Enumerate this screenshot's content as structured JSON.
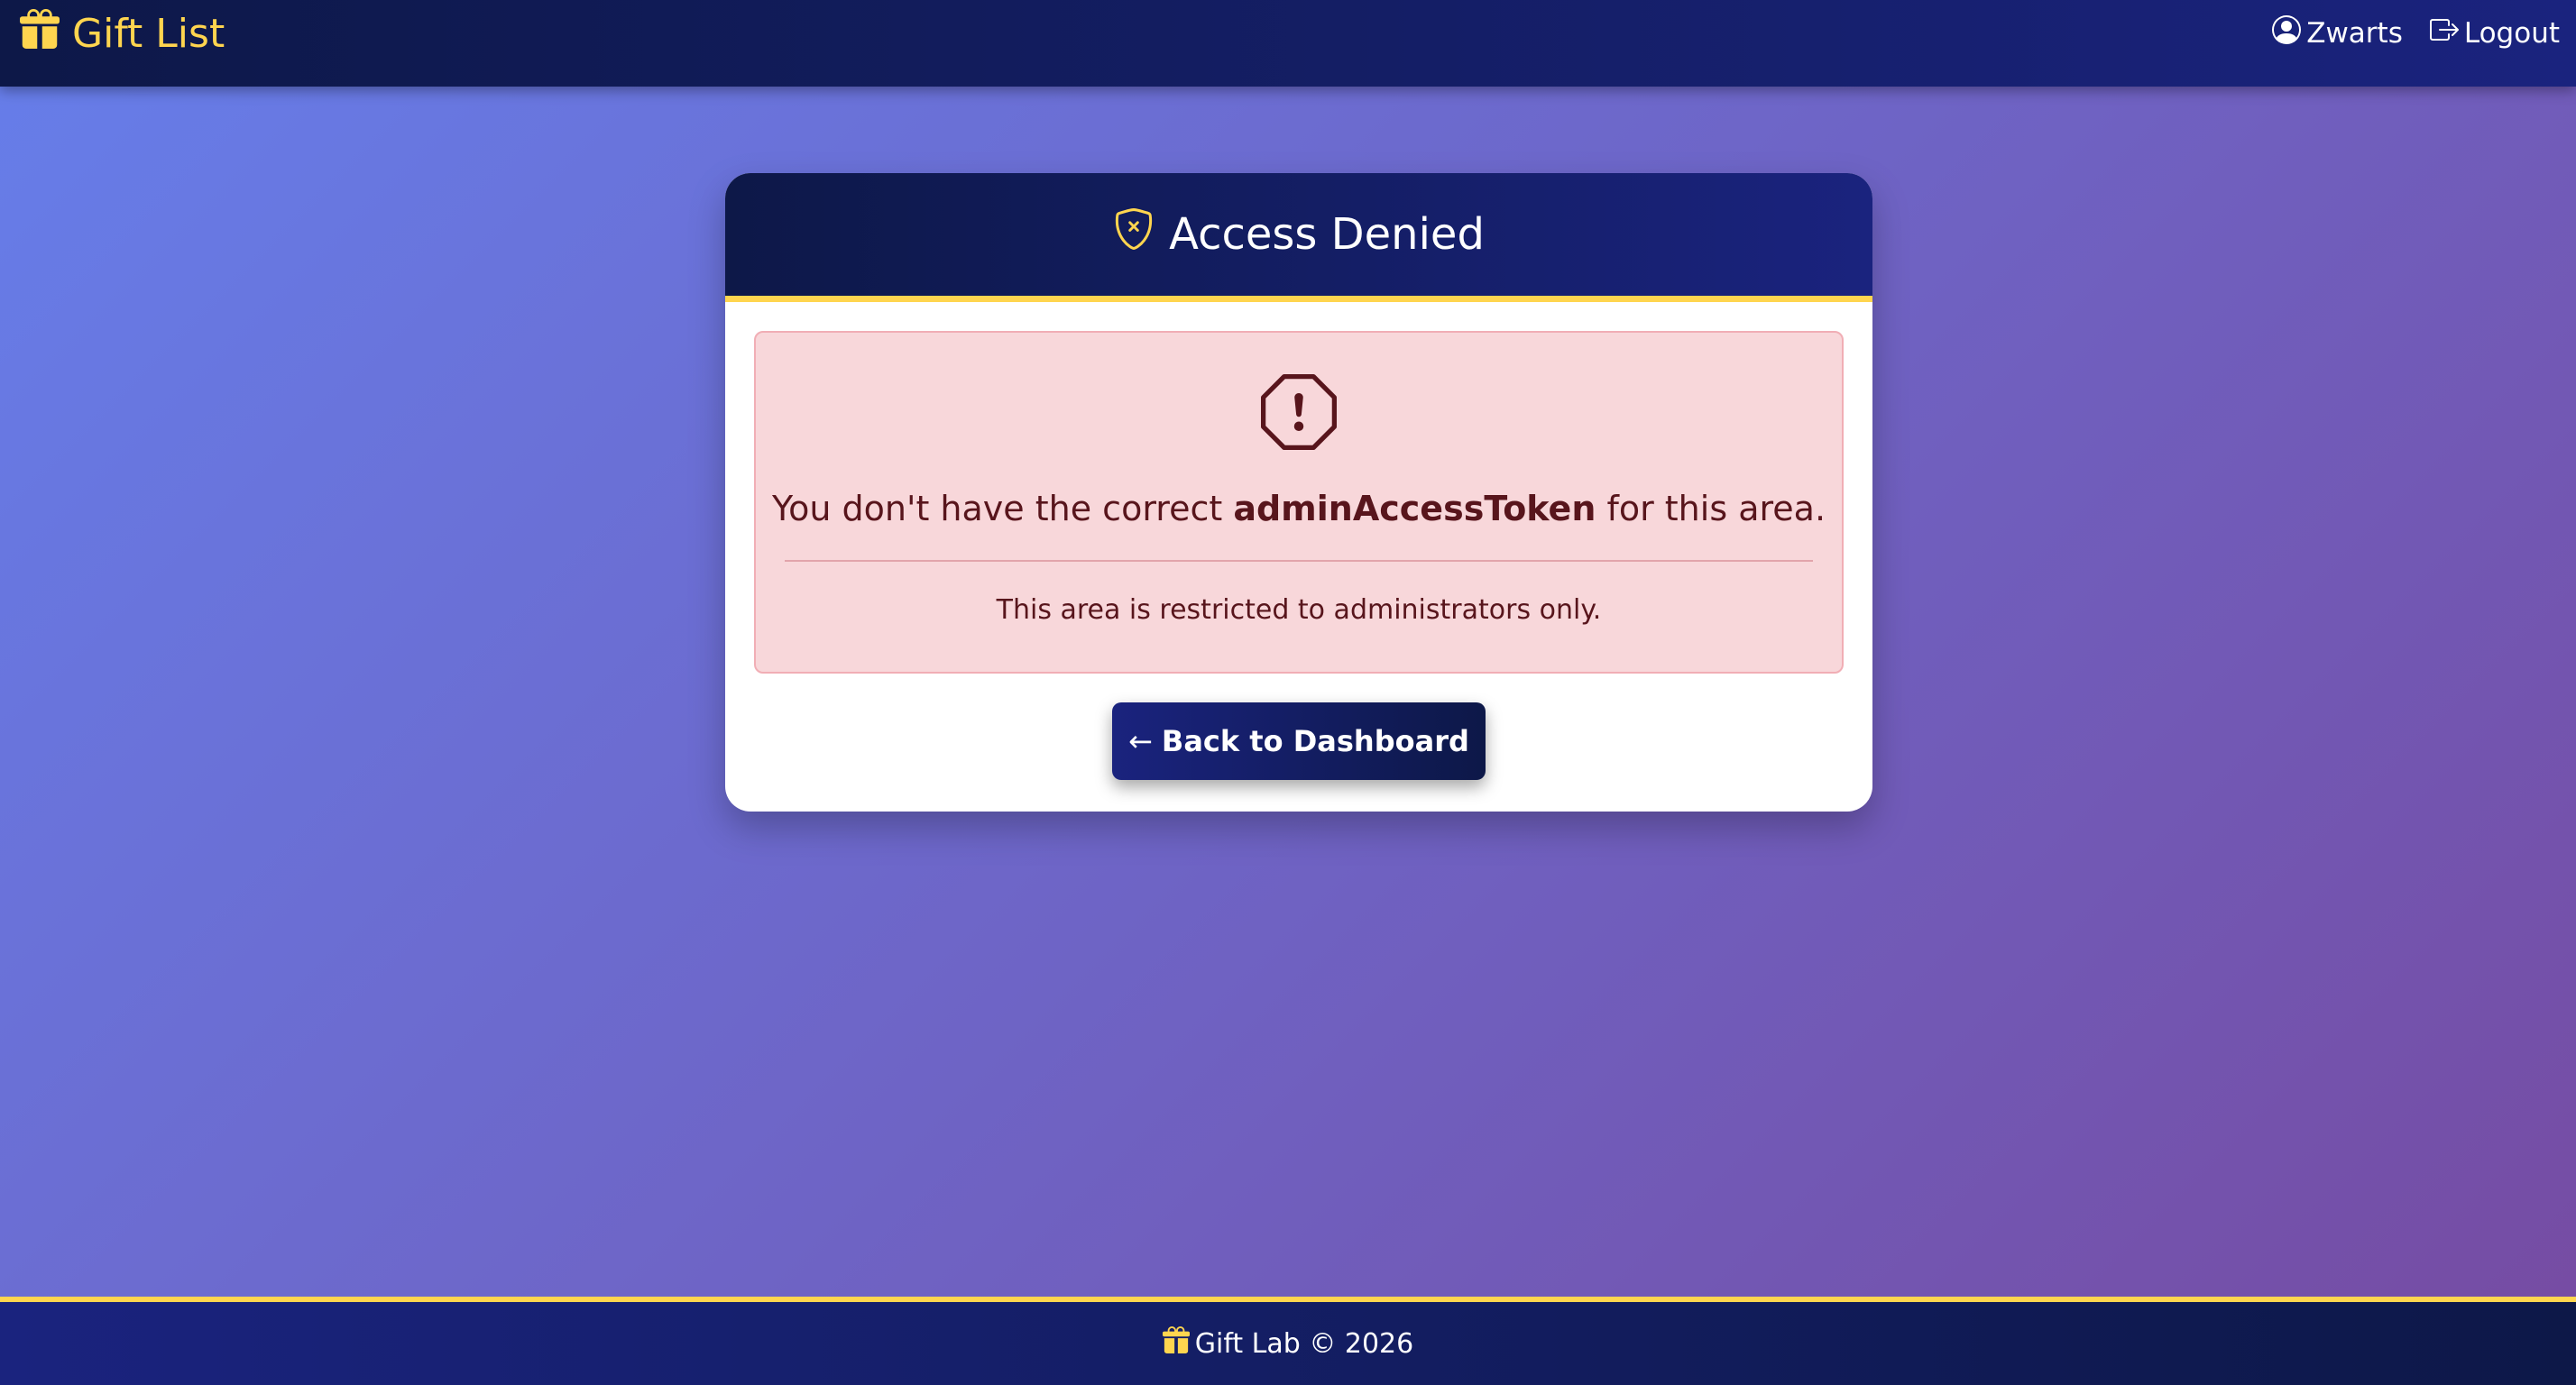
{
  "navbar": {
    "brand_label": "Gift List",
    "brand_icon": "gift-icon",
    "user_label": "Zwarts",
    "user_icon": "person-circle-icon",
    "logout_label": "Logout",
    "logout_icon": "box-arrow-right-icon"
  },
  "card": {
    "title": "Access Denied",
    "title_icon": "shield-x-icon",
    "alert": {
      "icon": "exclamation-octagon-icon",
      "message_prefix": "You don't have the correct ",
      "message_token": "adminAccessToken",
      "message_suffix": " for this area.",
      "note": "This area is restricted to administrators only."
    },
    "back_button": {
      "arrow": "←",
      "label": "Back to Dashboard"
    }
  },
  "footer": {
    "icon": "gift-icon",
    "text": "Gift Lab © 2026"
  },
  "colors": {
    "accent": "#ffd54f",
    "navy": "#1a237e",
    "navy_dark": "#0d1848",
    "bg_start": "#667eea",
    "bg_end": "#764ba2",
    "alert_bg": "#f8d7da",
    "alert_text": "#58151c"
  }
}
